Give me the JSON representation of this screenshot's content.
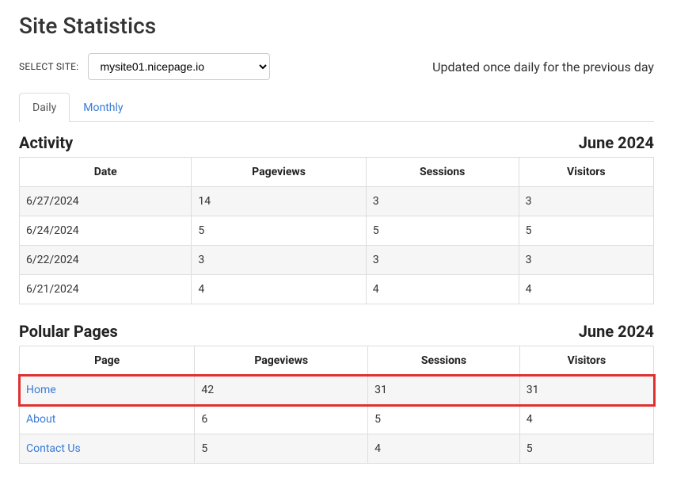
{
  "page_title": "Site Statistics",
  "select_site_label": "SELECT SITE:",
  "selected_site": "mysite01.nicepage.io",
  "update_note": "Updated once daily for the previous day",
  "tabs": {
    "daily": "Daily",
    "monthly": "Monthly"
  },
  "activity": {
    "title": "Activity",
    "period": "June 2024",
    "columns": {
      "date": "Date",
      "pageviews": "Pageviews",
      "sessions": "Sessions",
      "visitors": "Visitors"
    },
    "rows": [
      {
        "date": "6/27/2024",
        "pageviews": "14",
        "sessions": "3",
        "visitors": "3"
      },
      {
        "date": "6/24/2024",
        "pageviews": "5",
        "sessions": "5",
        "visitors": "5"
      },
      {
        "date": "6/22/2024",
        "pageviews": "3",
        "sessions": "3",
        "visitors": "3"
      },
      {
        "date": "6/21/2024",
        "pageviews": "4",
        "sessions": "4",
        "visitors": "4"
      }
    ]
  },
  "popular": {
    "title": "Polular Pages",
    "period": "June 2024",
    "columns": {
      "page": "Page",
      "pageviews": "Pageviews",
      "sessions": "Sessions",
      "visitors": "Visitors"
    },
    "rows": [
      {
        "page": "Home",
        "pageviews": "42",
        "sessions": "31",
        "visitors": "31",
        "highlight": true
      },
      {
        "page": "About",
        "pageviews": "6",
        "sessions": "5",
        "visitors": "4"
      },
      {
        "page": "Contact Us",
        "pageviews": "5",
        "sessions": "4",
        "visitors": "5"
      }
    ]
  }
}
